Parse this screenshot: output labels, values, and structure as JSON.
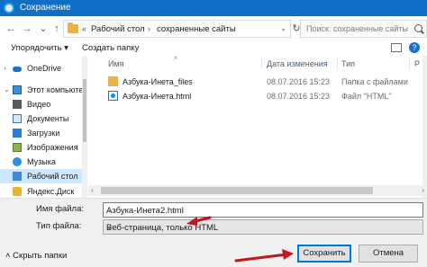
{
  "window": {
    "title": "Сохранение"
  },
  "nav": {
    "back_icon": "←",
    "forward_icon": "→",
    "up_icon": "↑",
    "address_prefix": "«",
    "breadcrumbs": [
      "Рабочий стол",
      "сохраненные сайты"
    ],
    "separator": "›",
    "dropdown_icon": "⌄",
    "refresh_icon": "↻",
    "search_placeholder": "Поиск: сохраненные сайты"
  },
  "toolbar": {
    "organize": "Упорядочить ▾",
    "new_folder": "Создать папку",
    "help": "?"
  },
  "sidebar": {
    "items": [
      {
        "label": "OneDrive",
        "icon": "cloud-icon"
      },
      {
        "label": "Этот компьютер",
        "icon": "computer-icon"
      },
      {
        "label": "Видео",
        "icon": "video-icon"
      },
      {
        "label": "Документы",
        "icon": "documents-icon"
      },
      {
        "label": "Загрузки",
        "icon": "downloads-icon"
      },
      {
        "label": "Изображения",
        "icon": "pictures-icon"
      },
      {
        "label": "Музыка",
        "icon": "music-icon"
      },
      {
        "label": "Рабочий стол",
        "icon": "desktop-icon",
        "selected": true
      },
      {
        "label": "Яндекс.Диск",
        "icon": "yandex-disk-icon"
      }
    ]
  },
  "filelist": {
    "columns": {
      "name": "Имя",
      "date": "Дата изменения",
      "type": "Тип",
      "size": "Р"
    },
    "rows": [
      {
        "name": "Азбука-Инета_files",
        "date": "08.07.2016 15:23",
        "type": "Папка с файлами",
        "icon": "folder-icon"
      },
      {
        "name": "Азбука-Инета.html",
        "date": "08.07.2016 15:23",
        "type": "Файл \"HTML\"",
        "icon": "html-file-icon"
      }
    ]
  },
  "form": {
    "filename_label": "Имя файла:",
    "filename_value": "Азбука-Инета2.html",
    "filetype_label": "Тип файла:",
    "filetype_value": "Веб-страница, только HTML",
    "hide_folders": "˄  Скрыть папки",
    "save_button": "Сохранить",
    "cancel_button": "Отмена"
  },
  "colors": {
    "titlebar": "#0f6fc6",
    "annotation_arrow": "#c0171e",
    "selected": "#cce8ff"
  }
}
